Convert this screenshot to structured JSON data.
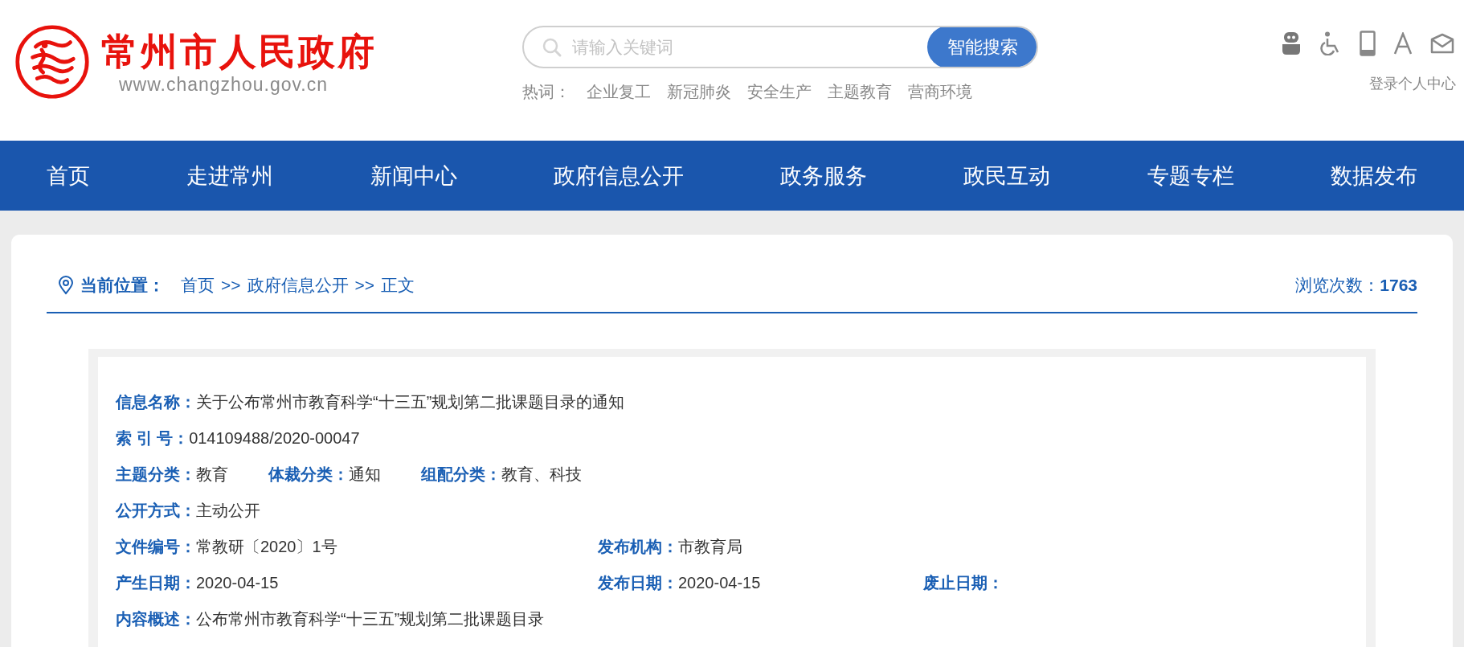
{
  "header": {
    "logo_title": "常州市人民政府",
    "logo_url": "www.changzhou.gov.cn",
    "search": {
      "placeholder": "请输入关键词",
      "button": "智能搜索"
    },
    "hot_label": "热词：",
    "hot_words": [
      "企业复工",
      "新冠肺炎",
      "安全生产",
      "主题教育",
      "营商环境"
    ],
    "login": "登录个人中心"
  },
  "nav": [
    "首页",
    "走进常州",
    "新闻中心",
    "政府信息公开",
    "政务服务",
    "政民互动",
    "专题专栏",
    "数据发布"
  ],
  "breadcrumb": {
    "label": "当前位置：",
    "items": [
      "首页",
      ">>",
      "政府信息公开",
      ">>",
      "正文"
    ],
    "views_label": "浏览次数：",
    "views": "1763"
  },
  "info": [
    {
      "kind": "inline",
      "fields": [
        {
          "label": "信息名称：",
          "value": "关于公布常州市教育科学“十三五”规划第二批课题目录的通知"
        }
      ]
    },
    {
      "kind": "inline",
      "fields": [
        {
          "label": "索 引 号：",
          "value": "014109488/2020-00047"
        }
      ]
    },
    {
      "kind": "inline",
      "fields": [
        {
          "label": "主题分类：",
          "value": "教育"
        },
        {
          "label": "体裁分类：",
          "value": "通知"
        },
        {
          "label": "组配分类：",
          "value": "教育、科技"
        }
      ]
    },
    {
      "kind": "inline",
      "fields": [
        {
          "label": "公开方式：",
          "value": "主动公开"
        }
      ]
    },
    {
      "kind": "grid",
      "fields": [
        {
          "label": "文件编号：",
          "value": "常教研〔2020〕1号"
        },
        {
          "label": "发布机构：",
          "value": "市教育局"
        }
      ]
    },
    {
      "kind": "grid",
      "fields": [
        {
          "label": "产生日期：",
          "value": "2020-04-15"
        },
        {
          "label": "发布日期：",
          "value": "2020-04-15"
        },
        {
          "label": "废止日期："
        }
      ]
    },
    {
      "kind": "inline",
      "fields": [
        {
          "label": "内容概述：",
          "value": "公布常州市教育科学“十三五”规划第二批课题目录"
        }
      ]
    }
  ]
}
